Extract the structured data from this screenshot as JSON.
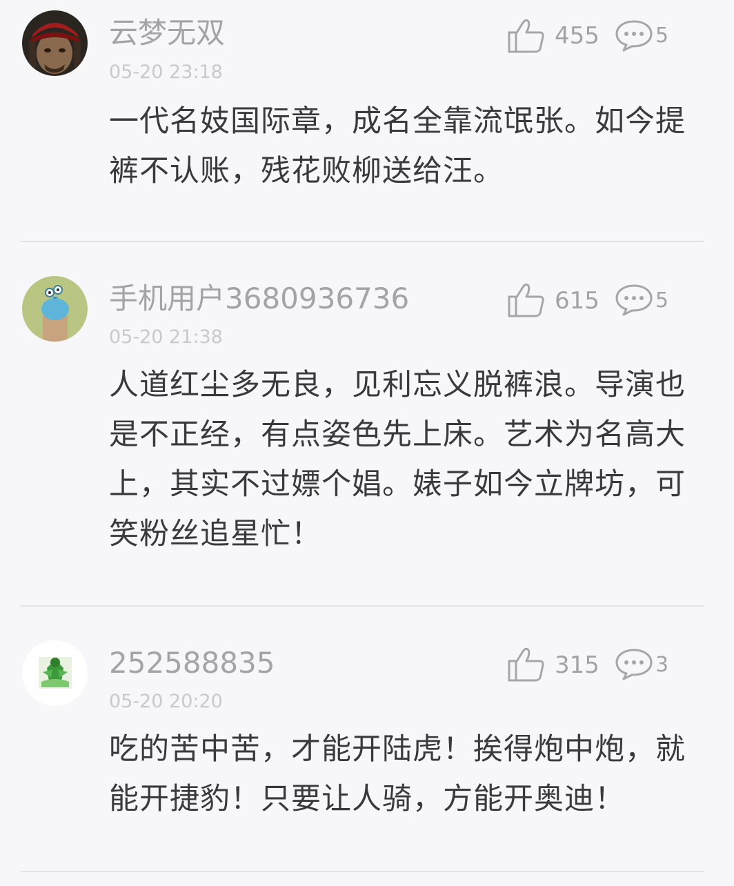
{
  "comments": [
    {
      "username": "云梦无双",
      "time": "05-20 23:18",
      "likes": "455",
      "replies": "5",
      "avatar_icon": "pirate-avatar-icon",
      "content": "一代名妓国际章，成名全靠流氓张。如今提裤不认账，残花败柳送给汪。"
    },
    {
      "username": "手机用户3680936736",
      "time": "05-20 21:38",
      "likes": "615",
      "replies": "5",
      "avatar_icon": "bird-avatar-icon",
      "content": "人道红尘多无良，见利忘义脱裤浪。导演也是不正经，有点姿色先上床。艺术为名高大上，其实不过嫖个娼。婊子如今立牌坊，可笑粉丝追星忙！"
    },
    {
      "username": "252588835",
      "time": "05-20 20:20",
      "likes": "315",
      "replies": "3",
      "avatar_icon": "green-figure-avatar-icon",
      "content": "吃的苦中苦，才能开陆虎！挨得炮中炮，就能开捷豹！只要让人骑，方能开奥迪！"
    }
  ],
  "colors": {
    "background": "#f7f6f9",
    "username": "#a4a4a4",
    "time": "#c9c9c9",
    "content": "#3a3a3a",
    "icon": "#a6a6a6",
    "divider": "#e2e1e5"
  }
}
